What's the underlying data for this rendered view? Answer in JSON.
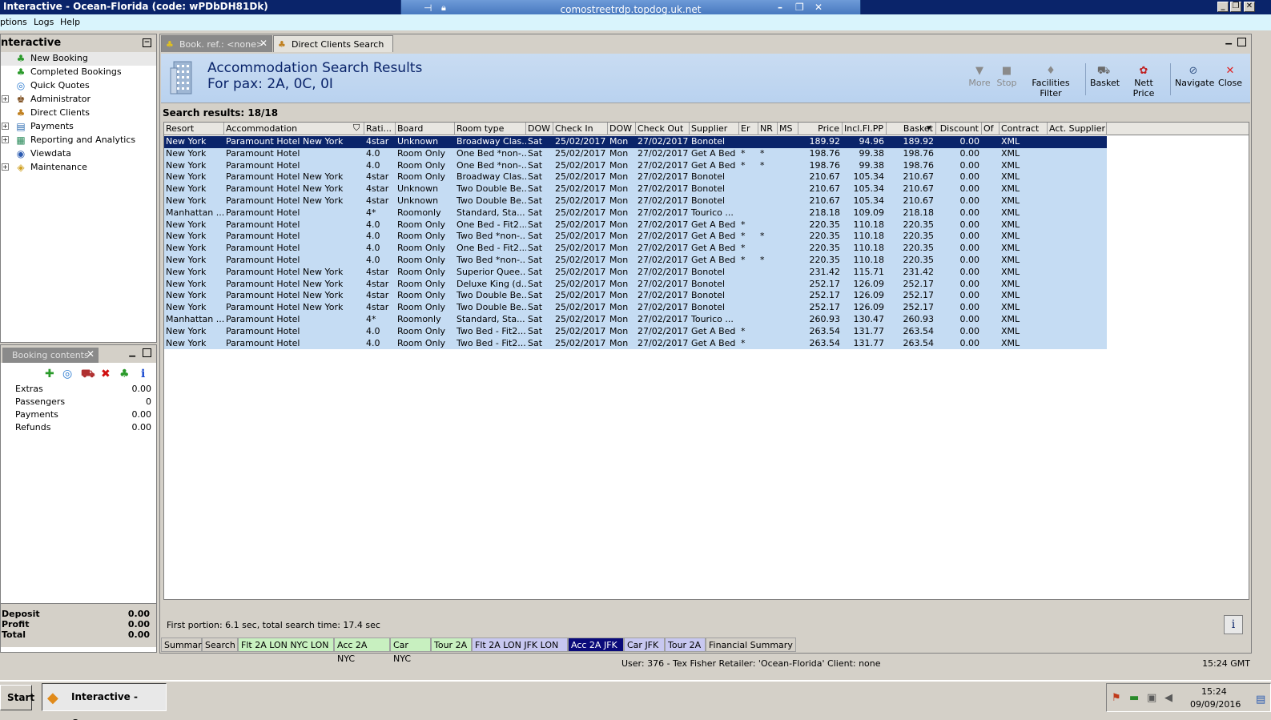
{
  "window": {
    "title": "Interactive - Ocean-Florida (code: wPDbDH81Dk)",
    "rdp_host": "comostreetrdp.topdog.uk.net"
  },
  "menu": [
    "ptions",
    "Logs",
    "Help"
  ],
  "nav": {
    "title": "nteractive",
    "items": [
      {
        "label": "New Booking",
        "icon": "palm-tree-icon",
        "expand": false
      },
      {
        "label": "Completed Bookings",
        "icon": "palm-tree-icon",
        "expand": false
      },
      {
        "label": "Quick Quotes",
        "icon": "globe-icon",
        "expand": false
      },
      {
        "label": "Administrator",
        "icon": "admin-icon",
        "expand": true
      },
      {
        "label": "Direct Clients",
        "icon": "clients-icon",
        "expand": false
      },
      {
        "label": "Payments",
        "icon": "payments-icon",
        "expand": true
      },
      {
        "label": "Reporting and Analytics",
        "icon": "reporting-icon",
        "expand": true
      },
      {
        "label": "Viewdata",
        "icon": "viewdata-icon",
        "expand": false
      },
      {
        "label": "Maintenance",
        "icon": "maintenance-icon",
        "expand": true
      }
    ]
  },
  "booking_contents": {
    "tab_label": "Booking contents",
    "rows": [
      {
        "label": "Extras",
        "value": "0.00"
      },
      {
        "label": "Passengers",
        "value": "0"
      },
      {
        "label": "Payments",
        "value": "0.00"
      },
      {
        "label": "Refunds",
        "value": "0.00"
      }
    ],
    "totals": [
      {
        "label": "Deposit",
        "value": "0.00"
      },
      {
        "label": "Profit",
        "value": "0.00"
      },
      {
        "label": "Total",
        "value": "0.00"
      }
    ]
  },
  "doc_tabs": [
    {
      "label": "Book. ref.: <none>",
      "active": true
    },
    {
      "label": "Direct Clients Search",
      "active": false
    }
  ],
  "header": {
    "title": "Accommodation Search Results",
    "subtitle": "For pax: 2A, 0C, 0I"
  },
  "toolbar": [
    {
      "label": "More",
      "icon": "triangle-down-icon",
      "disabled": true
    },
    {
      "label": "Stop",
      "icon": "stop-icon",
      "disabled": true
    },
    {
      "label": "Facilities Filter",
      "icon": "filter-icon",
      "disabled": false
    },
    {
      "label": "Basket",
      "icon": "basket-icon",
      "disabled": false
    },
    {
      "label": "Nett Price",
      "icon": "nett-price-icon",
      "disabled": false
    },
    {
      "label": "Navigate",
      "icon": "navigate-icon",
      "disabled": false
    },
    {
      "label": "Close",
      "icon": "close-icon",
      "disabled": false
    }
  ],
  "results_label": "Search results: 18/18",
  "table": {
    "columns": [
      "Resort",
      "Accommodation",
      "Rati...",
      "Board",
      "Room type",
      "DOW",
      "Check In",
      "DOW",
      "Check Out",
      "Supplier",
      "Er",
      "NR",
      "MS",
      "Price",
      "Incl.Fl.PP",
      "Basket",
      "Discount",
      "Of",
      "Contract",
      "Act. Supplier"
    ],
    "rows": [
      [
        "New York",
        "Paramount Hotel New York",
        "4star",
        "Unknown",
        "Broadway Clas...",
        "Sat",
        "25/02/2017",
        "Mon",
        "27/02/2017",
        "Bonotel",
        "",
        "",
        "",
        "189.92",
        "94.96",
        "189.92",
        "0.00",
        "",
        "XML",
        ""
      ],
      [
        "New York",
        "Paramount Hotel",
        "4.0",
        "Room Only",
        "One Bed *non-...",
        "Sat",
        "25/02/2017",
        "Mon",
        "27/02/2017",
        "Get A Bed",
        "*",
        "*",
        "",
        "198.76",
        "99.38",
        "198.76",
        "0.00",
        "",
        "XML",
        ""
      ],
      [
        "New York",
        "Paramount Hotel",
        "4.0",
        "Room Only",
        "One Bed *non-...",
        "Sat",
        "25/02/2017",
        "Mon",
        "27/02/2017",
        "Get A Bed",
        "*",
        "*",
        "",
        "198.76",
        "99.38",
        "198.76",
        "0.00",
        "",
        "XML",
        ""
      ],
      [
        "New York",
        "Paramount Hotel New York",
        "4star",
        "Room Only",
        "Broadway Clas...",
        "Sat",
        "25/02/2017",
        "Mon",
        "27/02/2017",
        "Bonotel",
        "",
        "",
        "",
        "210.67",
        "105.34",
        "210.67",
        "0.00",
        "",
        "XML",
        ""
      ],
      [
        "New York",
        "Paramount Hotel New York",
        "4star",
        "Unknown",
        "Two Double Be...",
        "Sat",
        "25/02/2017",
        "Mon",
        "27/02/2017",
        "Bonotel",
        "",
        "",
        "",
        "210.67",
        "105.34",
        "210.67",
        "0.00",
        "",
        "XML",
        ""
      ],
      [
        "New York",
        "Paramount Hotel New York",
        "4star",
        "Unknown",
        "Two Double Be...",
        "Sat",
        "25/02/2017",
        "Mon",
        "27/02/2017",
        "Bonotel",
        "",
        "",
        "",
        "210.67",
        "105.34",
        "210.67",
        "0.00",
        "",
        "XML",
        ""
      ],
      [
        "Manhattan ...",
        "Paramount Hotel",
        "4*",
        "Roomonly",
        "Standard, Sta...",
        "Sat",
        "25/02/2017",
        "Mon",
        "27/02/2017",
        "Tourico ...",
        "",
        "",
        "",
        "218.18",
        "109.09",
        "218.18",
        "0.00",
        "",
        "XML",
        ""
      ],
      [
        "New York",
        "Paramount Hotel",
        "4.0",
        "Room Only",
        "One Bed - Fit2...",
        "Sat",
        "25/02/2017",
        "Mon",
        "27/02/2017",
        "Get A Bed",
        "*",
        "",
        "",
        "220.35",
        "110.18",
        "220.35",
        "0.00",
        "",
        "XML",
        ""
      ],
      [
        "New York",
        "Paramount Hotel",
        "4.0",
        "Room Only",
        "Two Bed *non-...",
        "Sat",
        "25/02/2017",
        "Mon",
        "27/02/2017",
        "Get A Bed",
        "*",
        "*",
        "",
        "220.35",
        "110.18",
        "220.35",
        "0.00",
        "",
        "XML",
        ""
      ],
      [
        "New York",
        "Paramount Hotel",
        "4.0",
        "Room Only",
        "One Bed - Fit2...",
        "Sat",
        "25/02/2017",
        "Mon",
        "27/02/2017",
        "Get A Bed",
        "*",
        "",
        "",
        "220.35",
        "110.18",
        "220.35",
        "0.00",
        "",
        "XML",
        ""
      ],
      [
        "New York",
        "Paramount Hotel",
        "4.0",
        "Room Only",
        "Two Bed *non-...",
        "Sat",
        "25/02/2017",
        "Mon",
        "27/02/2017",
        "Get A Bed",
        "*",
        "*",
        "",
        "220.35",
        "110.18",
        "220.35",
        "0.00",
        "",
        "XML",
        ""
      ],
      [
        "New York",
        "Paramount Hotel New York",
        "4star",
        "Room Only",
        "Superior Quee...",
        "Sat",
        "25/02/2017",
        "Mon",
        "27/02/2017",
        "Bonotel",
        "",
        "",
        "",
        "231.42",
        "115.71",
        "231.42",
        "0.00",
        "",
        "XML",
        ""
      ],
      [
        "New York",
        "Paramount Hotel New York",
        "4star",
        "Room Only",
        "Deluxe King (d...",
        "Sat",
        "25/02/2017",
        "Mon",
        "27/02/2017",
        "Bonotel",
        "",
        "",
        "",
        "252.17",
        "126.09",
        "252.17",
        "0.00",
        "",
        "XML",
        ""
      ],
      [
        "New York",
        "Paramount Hotel New York",
        "4star",
        "Room Only",
        "Two Double Be...",
        "Sat",
        "25/02/2017",
        "Mon",
        "27/02/2017",
        "Bonotel",
        "",
        "",
        "",
        "252.17",
        "126.09",
        "252.17",
        "0.00",
        "",
        "XML",
        ""
      ],
      [
        "New York",
        "Paramount Hotel New York",
        "4star",
        "Room Only",
        "Two Double Be...",
        "Sat",
        "25/02/2017",
        "Mon",
        "27/02/2017",
        "Bonotel",
        "",
        "",
        "",
        "252.17",
        "126.09",
        "252.17",
        "0.00",
        "",
        "XML",
        ""
      ],
      [
        "Manhattan ...",
        "Paramount Hotel",
        "4*",
        "Roomonly",
        "Standard, Sta...",
        "Sat",
        "25/02/2017",
        "Mon",
        "27/02/2017",
        "Tourico ...",
        "",
        "",
        "",
        "260.93",
        "130.47",
        "260.93",
        "0.00",
        "",
        "XML",
        ""
      ],
      [
        "New York",
        "Paramount Hotel",
        "4.0",
        "Room Only",
        "Two Bed - Fit2...",
        "Sat",
        "25/02/2017",
        "Mon",
        "27/02/2017",
        "Get A Bed",
        "*",
        "",
        "",
        "263.54",
        "131.77",
        "263.54",
        "0.00",
        "",
        "XML",
        ""
      ],
      [
        "New York",
        "Paramount Hotel",
        "4.0",
        "Room Only",
        "Two Bed - Fit2...",
        "Sat",
        "25/02/2017",
        "Mon",
        "27/02/2017",
        "Get A Bed",
        "*",
        "",
        "",
        "263.54",
        "131.77",
        "263.54",
        "0.00",
        "",
        "XML",
        ""
      ]
    ]
  },
  "status_text": "First portion: 6.1 sec, total search time: 17.4 sec",
  "bottom_tabs": [
    {
      "label": "Summary",
      "color": "#d4d0c8",
      "text": "#000000"
    },
    {
      "label": "Search",
      "color": "#d4d0c8",
      "text": "#000000"
    },
    {
      "label": "Flt 2A LON NYC LON",
      "color": "#c8f0c0",
      "text": "#000000"
    },
    {
      "label": "Acc 2A NYC",
      "color": "#c8f0c0",
      "text": "#000000"
    },
    {
      "label": "Car NYC",
      "color": "#c8f0c0",
      "text": "#000000"
    },
    {
      "label": "Tour 2A",
      "color": "#c8f0c0",
      "text": "#000000"
    },
    {
      "label": "Flt 2A LON JFK LON",
      "color": "#c8c8f0",
      "text": "#000000"
    },
    {
      "label": "Acc 2A JFK",
      "color": "#0a0a7a",
      "text": "#ffffff"
    },
    {
      "label": "Car JFK",
      "color": "#c8c8f0",
      "text": "#000000"
    },
    {
      "label": "Tour 2A",
      "color": "#c8c8f0",
      "text": "#000000"
    },
    {
      "label": "Financial Summary",
      "color": "#d4d0c8",
      "text": "#000000"
    }
  ],
  "user_status": "User: 376 - Tex Fisher   Retailer: 'Ocean-Florida'   Client: none",
  "clock_status": "15:24 GMT",
  "taskbar": {
    "start_label": "Start",
    "task_label": "Interactive - Ocea...",
    "clock_time": "15:24",
    "clock_date": "09/09/2016"
  }
}
